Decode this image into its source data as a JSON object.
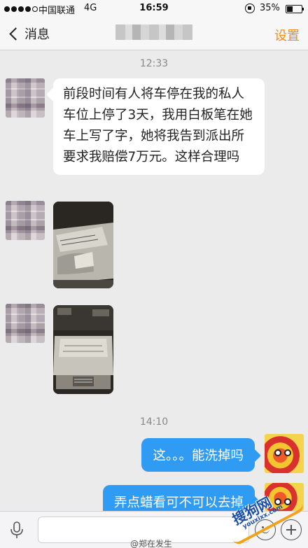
{
  "status_bar": {
    "carrier": "中国联通",
    "network": "4G",
    "time": "16:59",
    "battery": "35%"
  },
  "nav": {
    "back_label": "消息",
    "settings_label": "设置"
  },
  "messages": {
    "time_1": "12:33",
    "text_1": "前段时间有人将车停在我的私人车位上停了3天，我用白板笔在她车上写了字，她将我告到派出所要求我赔偿7万元。这样合理吗",
    "time_2": "14:10",
    "reply_1": "这。。。能洗掉吗",
    "reply_2": "弄点蜡看可不可以去掉"
  },
  "watermarks": {
    "weibo": "@郑在发生",
    "site_cn": "搜狗网",
    "site_en": "youxixx.com"
  },
  "colors": {
    "accent": "#f08c1a",
    "bubble_out": "#2f9bf2",
    "background": "#ebebeb"
  }
}
